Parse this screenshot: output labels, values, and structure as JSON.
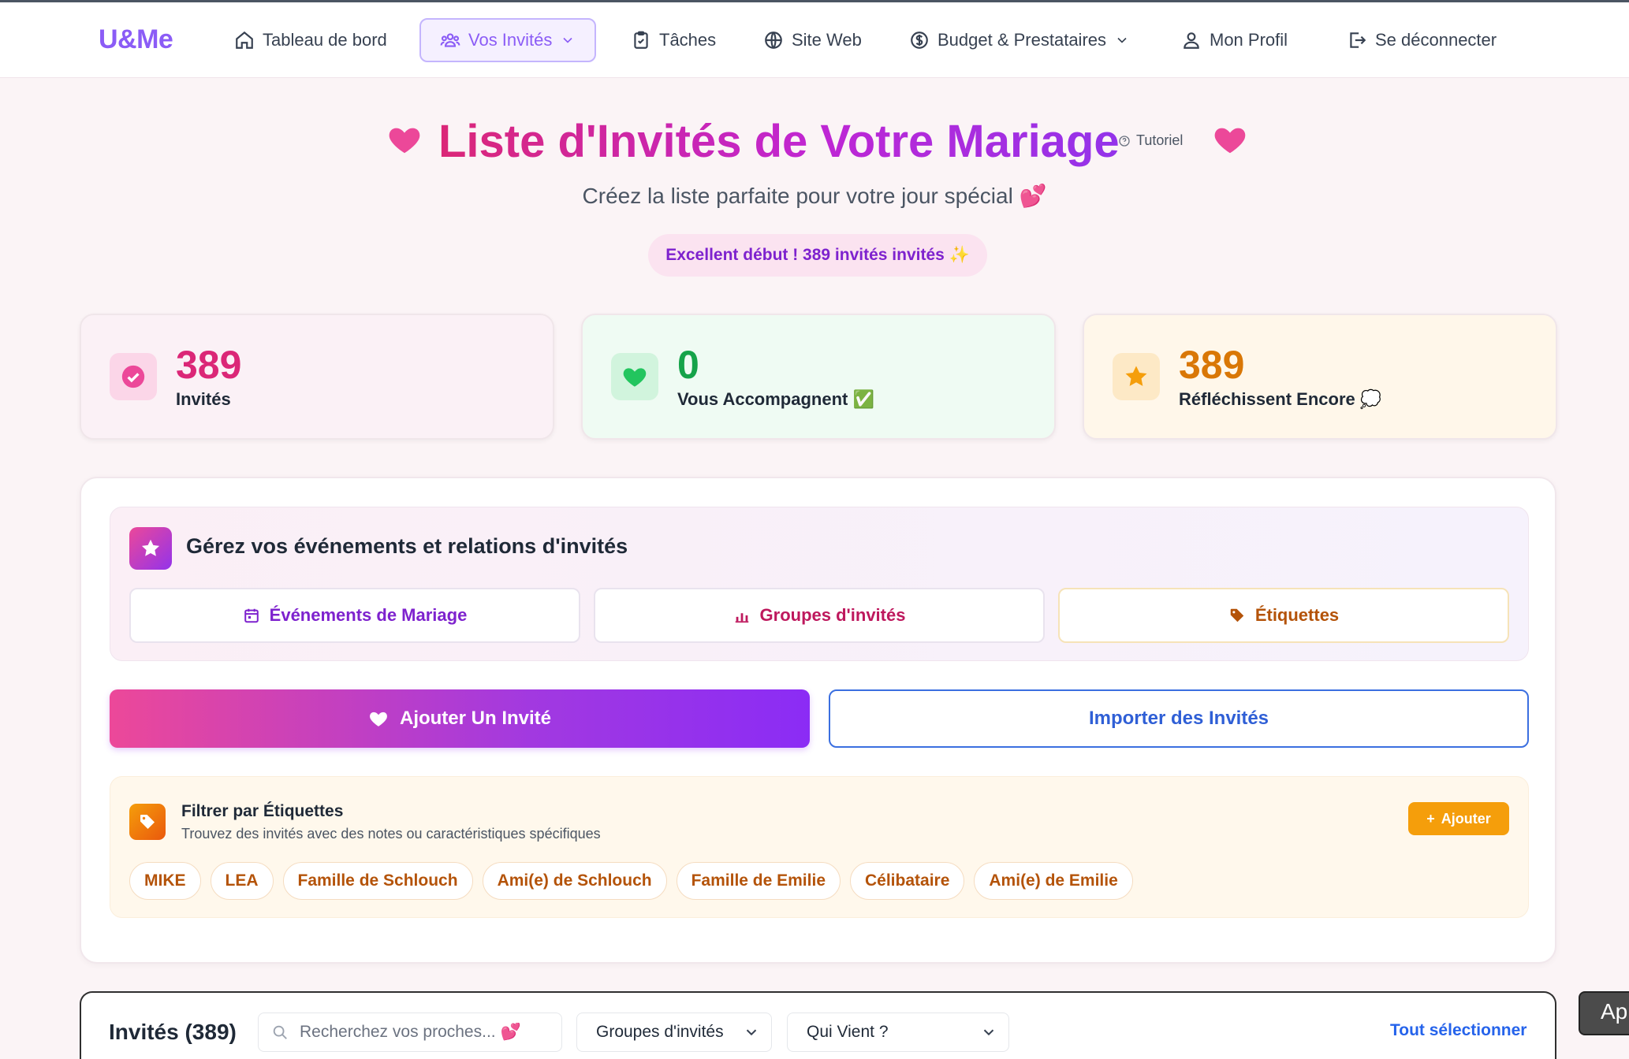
{
  "app": {
    "logo": "U&Me"
  },
  "nav": {
    "dashboard": "Tableau de bord",
    "guests": "Vos Invités",
    "tasks": "Tâches",
    "website": "Site Web",
    "budget": "Budget & Prestataires",
    "profile": "Mon Profil",
    "logout": "Se déconnecter"
  },
  "header": {
    "title": "Liste d'Invités de Votre Mariage",
    "tutorial": "Tutoriel",
    "subtitle": "Créez la liste parfaite pour votre jour spécial 💕",
    "progress_message": "Excellent début ! 389 invités invités ✨"
  },
  "stats": [
    {
      "value": "389",
      "label": "Invités",
      "color": "#db2777"
    },
    {
      "value": "0",
      "label": "Vous Accompagnent ✅",
      "color": "#16a34a"
    },
    {
      "value": "389",
      "label": "Réfléchissent Encore 💭",
      "color": "#d97706"
    }
  ],
  "manage": {
    "title": "Gérez vos événements et relations d'invités",
    "events_button": "Événements de Mariage",
    "groups_button": "Groupes d'invités",
    "tags_button": "Étiquettes"
  },
  "actions": {
    "add_guest": "Ajouter Un Invité",
    "import_guests": "Importer des Invités"
  },
  "filter": {
    "title": "Filtrer par Étiquettes",
    "description": "Trouvez des invités avec des notes ou caractéristiques spécifiques",
    "add_button": "Ajouter",
    "tags": [
      "MIKE",
      "LEA",
      "Famille de Schlouch",
      "Ami(e) de Schlouch",
      "Famille de Emilie",
      "Célibataire",
      "Ami(e) de Emilie"
    ]
  },
  "guest_list": {
    "title": "Invités (389)",
    "search_placeholder": "Recherchez vos proches... 💕",
    "group_select": "Groupes d'invités",
    "attendance_select": "Qui Vient ?",
    "select_all": "Tout sélectionner"
  },
  "floating": {
    "label": "Ap"
  },
  "colors": {
    "brand_purple": "#8b5cf6",
    "brand_pink": "#ec4899",
    "accent_amber": "#f59e0b",
    "link_blue": "#2563eb"
  }
}
